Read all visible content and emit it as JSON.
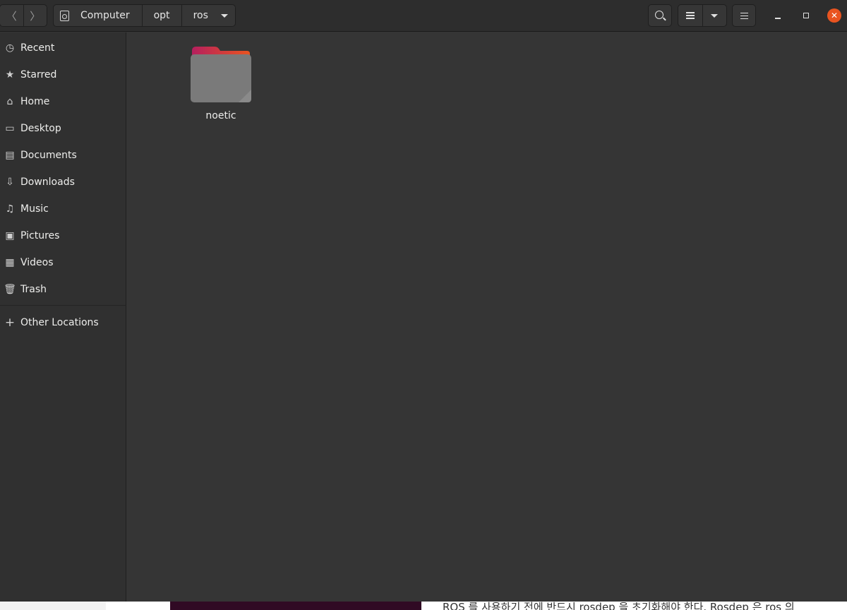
{
  "headerbar": {
    "back_icon": "chevron-left-icon",
    "forward_icon": "chevron-right-icon",
    "path": [
      "Computer",
      "opt",
      "ros"
    ],
    "path_icon": "drive-icon",
    "buttons": {
      "search_icon": "search-icon",
      "view_icon": "list-view-icon",
      "view_menu_icon": "chevron-down-icon",
      "menu_icon": "hamburger-menu-icon"
    },
    "window_controls": {
      "minimize_icon": "minimize-icon",
      "maximize_icon": "maximize-icon",
      "close_icon": "close-icon",
      "close_color": "#e95420"
    }
  },
  "sidebar": {
    "items": [
      {
        "label": "Recent",
        "icon": "clock-icon",
        "glyph": "◷"
      },
      {
        "label": "Starred",
        "icon": "star-icon",
        "glyph": "★"
      },
      {
        "label": "Home",
        "icon": "home-icon",
        "glyph": "⌂"
      },
      {
        "label": "Desktop",
        "icon": "desktop-icon",
        "glyph": "▭"
      },
      {
        "label": "Documents",
        "icon": "document-icon",
        "glyph": "▤"
      },
      {
        "label": "Downloads",
        "icon": "download-icon",
        "glyph": "⇩"
      },
      {
        "label": "Music",
        "icon": "music-icon",
        "glyph": "♫"
      },
      {
        "label": "Pictures",
        "icon": "picture-icon",
        "glyph": "▣"
      },
      {
        "label": "Videos",
        "icon": "video-icon",
        "glyph": "▦"
      },
      {
        "label": "Trash",
        "icon": "trash-icon",
        "glyph": "🗑"
      }
    ],
    "other_locations": {
      "label": "Other Locations",
      "icon": "plus-icon",
      "glyph": "+"
    }
  },
  "content": {
    "items": [
      {
        "name": "noetic",
        "type": "folder",
        "icon": "folder-icon"
      }
    ],
    "colors": {
      "folder_body": "#7a7a7a",
      "folder_tab_left": "#c7215d",
      "folder_tab_right": "#e95420"
    }
  },
  "background": {
    "text": "ROS 를 사용하기 전에 반드시 rosdep 을 초기화해야 한다. Rosdep 은 ros 의"
  }
}
